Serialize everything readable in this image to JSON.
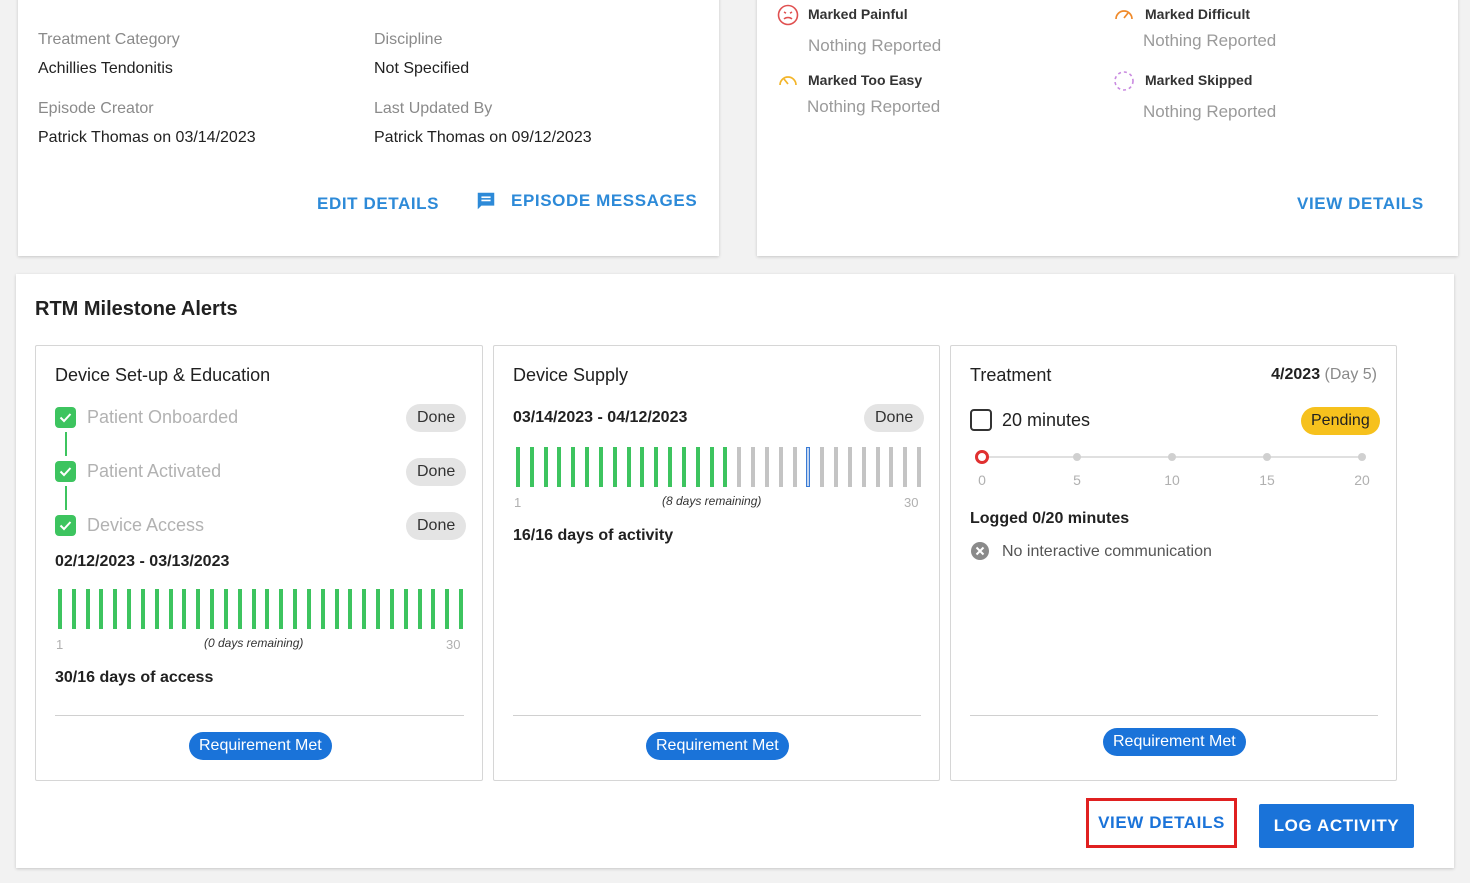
{
  "episode": {
    "treatment_category_label": "Treatment Category",
    "treatment_category_value": "Achillies Tendonitis",
    "discipline_label": "Discipline",
    "discipline_value": "Not Specified",
    "creator_label": "Episode Creator",
    "creator_value": "Patrick Thomas on 03/14/2023",
    "updated_label": "Last Updated By",
    "updated_value": "Patrick Thomas on 09/12/2023",
    "edit_details": "EDIT DETAILS",
    "episode_messages": "EPISODE MESSAGES"
  },
  "feedback": {
    "painful_label": "Marked Painful",
    "painful_value": "Nothing Reported",
    "difficult_label": "Marked Difficult",
    "difficult_value": "Nothing Reported",
    "too_easy_label": "Marked Too Easy",
    "too_easy_value": "Nothing Reported",
    "skipped_label": "Marked Skipped",
    "skipped_value": "Nothing Reported",
    "view_details": "VIEW DETAILS",
    "colors": {
      "painful": "#e05050",
      "difficult": "#f08a2a",
      "too_easy": "#f3b52a",
      "skipped": "#c98ae0"
    }
  },
  "rtm": {
    "title": "RTM Milestone Alerts",
    "setup": {
      "title": "Device Set-up & Education",
      "steps": [
        {
          "label": "Patient Onboarded",
          "status": "Done"
        },
        {
          "label": "Patient Activated",
          "status": "Done"
        },
        {
          "label": "Device Access",
          "status": "Done"
        }
      ],
      "date_range": "02/12/2023 - 03/13/2023",
      "bars_total": 30,
      "bars_active": 30,
      "axis_start": "1",
      "axis_end": "30",
      "remaining": "(0 days remaining)",
      "summary": "30/16 days of access",
      "requirement": "Requirement Met"
    },
    "supply": {
      "title": "Device Supply",
      "date_range": "03/14/2023 - 04/12/2023",
      "status": "Done",
      "bars_total": 30,
      "bars_active": 16,
      "current_day": 22,
      "axis_start": "1",
      "axis_end": "30",
      "remaining": "(8 days remaining)",
      "summary": "16/16 days of activity",
      "requirement": "Requirement Met"
    },
    "treatment": {
      "title": "Treatment",
      "period": "4/2023",
      "day": "(Day 5)",
      "minutes_label": "20 minutes",
      "status": "Pending",
      "slider_ticks": [
        "0",
        "5",
        "10",
        "15",
        "20"
      ],
      "slider_value": 0,
      "slider_max": 20,
      "logged": "Logged 0/20 minutes",
      "communication": "No interactive communication",
      "requirement": "Requirement Met"
    },
    "view_details": "VIEW DETAILS",
    "log_activity": "LOG ACTIVITY",
    "colors": {
      "active": "#3dc45f",
      "inactive": "#c4c4c4",
      "current": "#3a7bd5",
      "primary": "#1a73d9"
    }
  }
}
